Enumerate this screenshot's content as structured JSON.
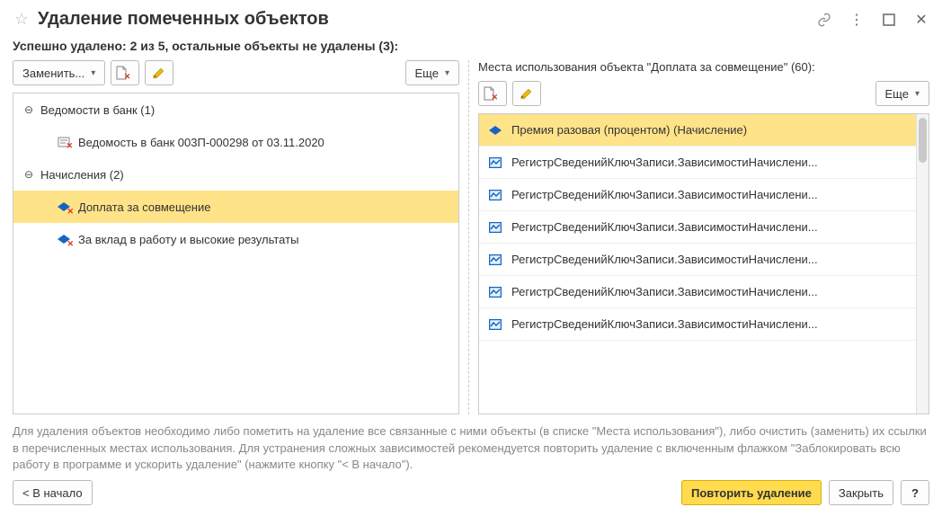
{
  "title": "Удаление помеченных объектов",
  "status": "Успешно удалено: 2 из 5, остальные объекты не удалены (3):",
  "leftToolbar": {
    "replace": "Заменить...",
    "more": "Еще"
  },
  "tree": {
    "group1": {
      "label": "Ведомости в банк (1)"
    },
    "item1": {
      "label": "Ведомость в банк 003П-000298 от 03.11.2020"
    },
    "group2": {
      "label": "Начисления (2)"
    },
    "item2": {
      "label": "Доплата за совмещение"
    },
    "item3": {
      "label": "За вклад в работу и высокие результаты"
    }
  },
  "usage": {
    "header": "Места использования объекта \"Доплата за совмещение\" (60):",
    "more": "Еще",
    "rows": {
      "r0": "Премия разовая (процентом) (Начисление)",
      "r1": "РегистрСведенийКлючЗаписи.ЗависимостиНачислени...",
      "r2": "РегистрСведенийКлючЗаписи.ЗависимостиНачислени...",
      "r3": "РегистрСведенийКлючЗаписи.ЗависимостиНачислени...",
      "r4": "РегистрСведенийКлючЗаписи.ЗависимостиНачислени...",
      "r5": "РегистрСведенийКлючЗаписи.ЗависимостиНачислени...",
      "r6": "РегистрСведенийКлючЗаписи.ЗависимостиНачислени..."
    }
  },
  "info": "Для удаления объектов необходимо либо пометить на удаление все связанные с ними объекты (в списке \"Места использования\"), либо очистить (заменить) их ссылки в перечисленных местах использования. Для устранения сложных зависимостей рекомендуется повторить удаление с включенным флажком \"Заблокировать всю работу в программе и ускорить удаление\" (нажмите кнопку \"< В начало\").",
  "footer": {
    "back": "< В начало",
    "repeat": "Повторить удаление",
    "close": "Закрыть",
    "help": "?"
  }
}
